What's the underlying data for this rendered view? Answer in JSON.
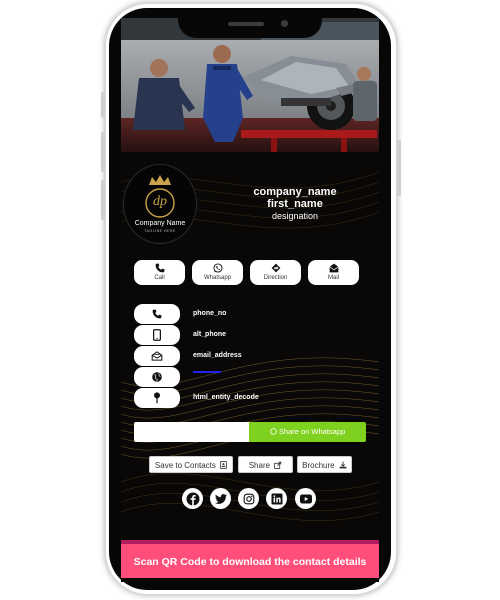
{
  "profile": {
    "company_name": "company_name",
    "first_name": "first_name",
    "designation": "designation",
    "logo_initials": "dp",
    "logo_title": "Company Name",
    "logo_tagline": "TAGLINE HERE"
  },
  "actions": [
    {
      "label": "Call",
      "icon": "phone-icon"
    },
    {
      "label": "Whatsapp",
      "icon": "whatsapp-icon"
    },
    {
      "label": "Direction",
      "icon": "direction-icon"
    },
    {
      "label": "Mail",
      "icon": "mail-icon"
    }
  ],
  "contact_info": [
    {
      "icon": "phone-icon",
      "value": "phone_no"
    },
    {
      "icon": "mobile-icon",
      "value": "alt_phone"
    },
    {
      "icon": "envelope-open-icon",
      "value": "email_address"
    },
    {
      "icon": "globe-icon",
      "value": ""
    },
    {
      "icon": "map-pin-icon",
      "value": "html_entity_decode"
    }
  ],
  "whatsapp_share": {
    "placeholder": "",
    "button_label": "Share on Whatsapp"
  },
  "buttons": {
    "save_contacts": "Save to Contacts",
    "share": "Share",
    "brochure": "Brochure"
  },
  "social": [
    "facebook-icon",
    "twitter-icon",
    "instagram-icon",
    "linkedin-icon",
    "youtube-icon"
  ],
  "qr_banner": "Scan QR Code to download the contact details",
  "colors": {
    "whatsapp_green": "#7fd11f",
    "banner_pink": "#ff4e7a",
    "gold": "#c9a44a",
    "background": "#0a0806"
  }
}
